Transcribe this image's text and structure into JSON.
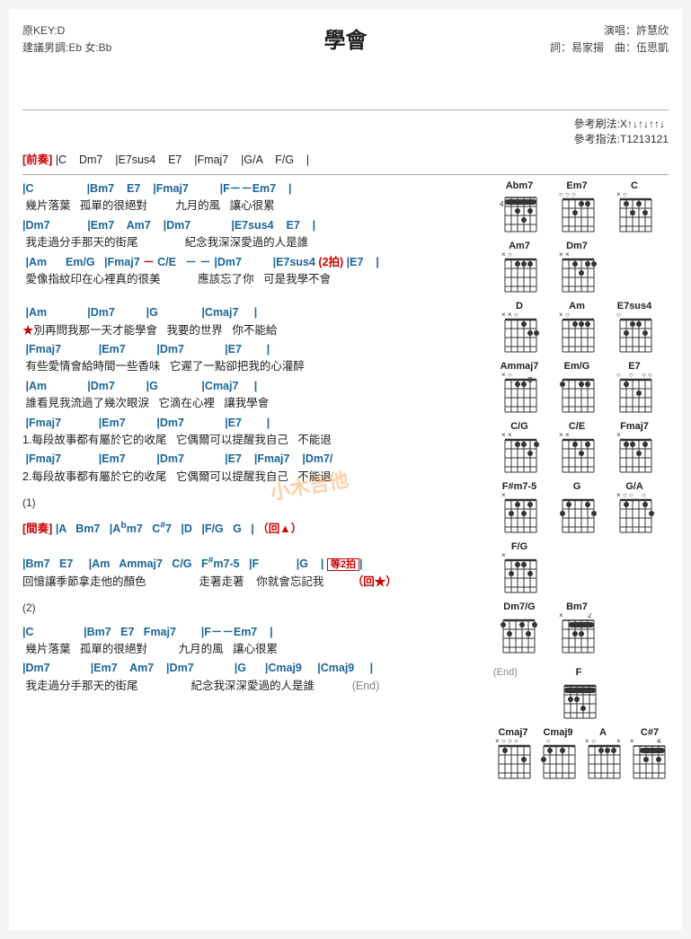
{
  "title": "學會",
  "meta": {
    "key": "原KEY:D",
    "suggestion": "建議男調:Eb 女:Bb",
    "singer": "演唱：許慧欣",
    "lyricist": "詞：易家揚",
    "composer": "曲：伍思凱",
    "strum_pattern": "參考刷法:X↑↓↑↓↑↑↓",
    "finger_pattern": "參考指法:T1213121"
  },
  "prelude": "[前奏] |C    Dm7   |E7sus4   E7   |Fmaj7   |G/A   F/G   |",
  "sections": [],
  "watermark": "小木吉他"
}
